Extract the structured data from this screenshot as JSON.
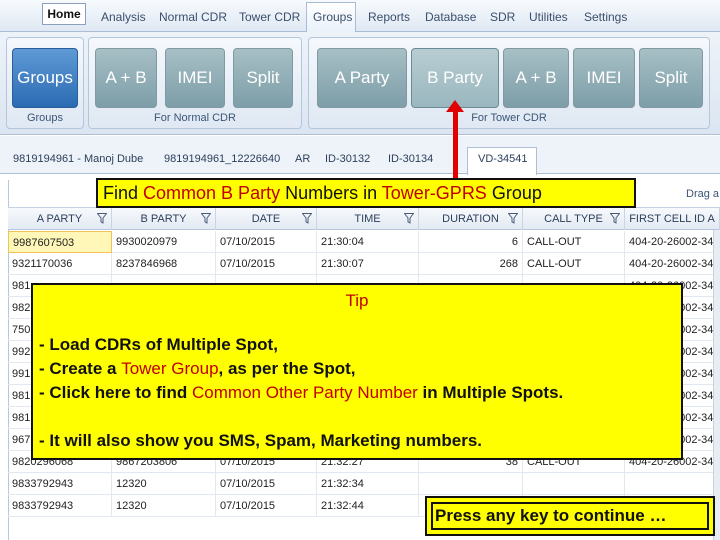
{
  "menu": {
    "home": "Home",
    "items": [
      "Analysis",
      "Normal CDR",
      "Tower CDR",
      "Groups",
      "Reports",
      "Database",
      "SDR",
      "Utilities",
      "Settings"
    ]
  },
  "ribbon": {
    "groups_button": "Groups",
    "groups_label": "Groups",
    "normal_buttons": [
      "A + B",
      "IMEI",
      "Split"
    ],
    "normal_label": "For Normal CDR",
    "tower_buttons": [
      "A Party",
      "B Party",
      "A + B",
      "IMEI",
      "Split"
    ],
    "tower_label": "For Tower CDR"
  },
  "party_tabs": [
    "9819194961 - Manoj Dube",
    "9819194961_12226640",
    "AR",
    "ID-30132",
    "ID-30134",
    "VD-34541"
  ],
  "grid": {
    "drag_hint": "Drag a",
    "columns": [
      "A PARTY",
      "B PARTY",
      "DATE",
      "TIME",
      "DURATION",
      "CALL TYPE",
      "FIRST CELL ID A"
    ],
    "rows": [
      [
        "9987607503",
        "9930020979",
        "07/10/2015",
        "21:30:04",
        "6",
        "CALL-OUT",
        "404-20-26002-34..."
      ],
      [
        "9321170036",
        "8237846968",
        "07/10/2015",
        "21:30:07",
        "268",
        "CALL-OUT",
        "404-20-26002-34..."
      ],
      [
        "981",
        "",
        "",
        "",
        "",
        "",
        "404-20-26002-34..."
      ],
      [
        "982",
        "",
        "",
        "",
        "",
        "",
        "404-20-26002-34..."
      ],
      [
        "750",
        "",
        "",
        "",
        "",
        "",
        "404-20-26002-34..."
      ],
      [
        "992",
        "",
        "",
        "",
        "",
        "",
        "404-20-26002-34..."
      ],
      [
        "991",
        "",
        "",
        "",
        "",
        "",
        "404-20-26002-34..."
      ],
      [
        "981",
        "",
        "",
        "",
        "",
        "",
        "404-20-26002-34..."
      ],
      [
        "981",
        "",
        "",
        "",
        "",
        "",
        "404-20-26002-34..."
      ],
      [
        "967",
        "",
        "",
        "",
        "",
        "",
        "404-20-26002-34..."
      ],
      [
        "9820296068",
        "9867203806",
        "07/10/2015",
        "21:32:27",
        "38",
        "CALL-OUT",
        "404-20-26002-34..."
      ],
      [
        "9833792943",
        "12320",
        "07/10/2015",
        "21:32:34",
        "",
        "",
        ""
      ],
      [
        "9833792943",
        "12320",
        "07/10/2015",
        "21:32:44",
        "",
        "",
        ""
      ]
    ]
  },
  "annotation": {
    "title_parts": [
      "Find ",
      "Common B Party",
      " Numbers in ",
      "Tower-GPRS",
      " Group"
    ],
    "tip_title": "Tip",
    "line1": "- Load CDRs of Multiple Spot,",
    "line2_parts": [
      "- Create a ",
      "Tower Group",
      ", as per the Spot,"
    ],
    "line3_parts": [
      "- Click here to find ",
      "Common Other Party Number",
      " in Multiple Spots."
    ],
    "line4": "- It will also show you SMS, Spam, Marketing numbers.",
    "press": "Press any key to continue …"
  },
  "colors": {
    "highlight": "#ffff00",
    "emphasis": "#c00000",
    "arrow": "#e00000",
    "ribbon_primary": "#2c6bb3"
  }
}
